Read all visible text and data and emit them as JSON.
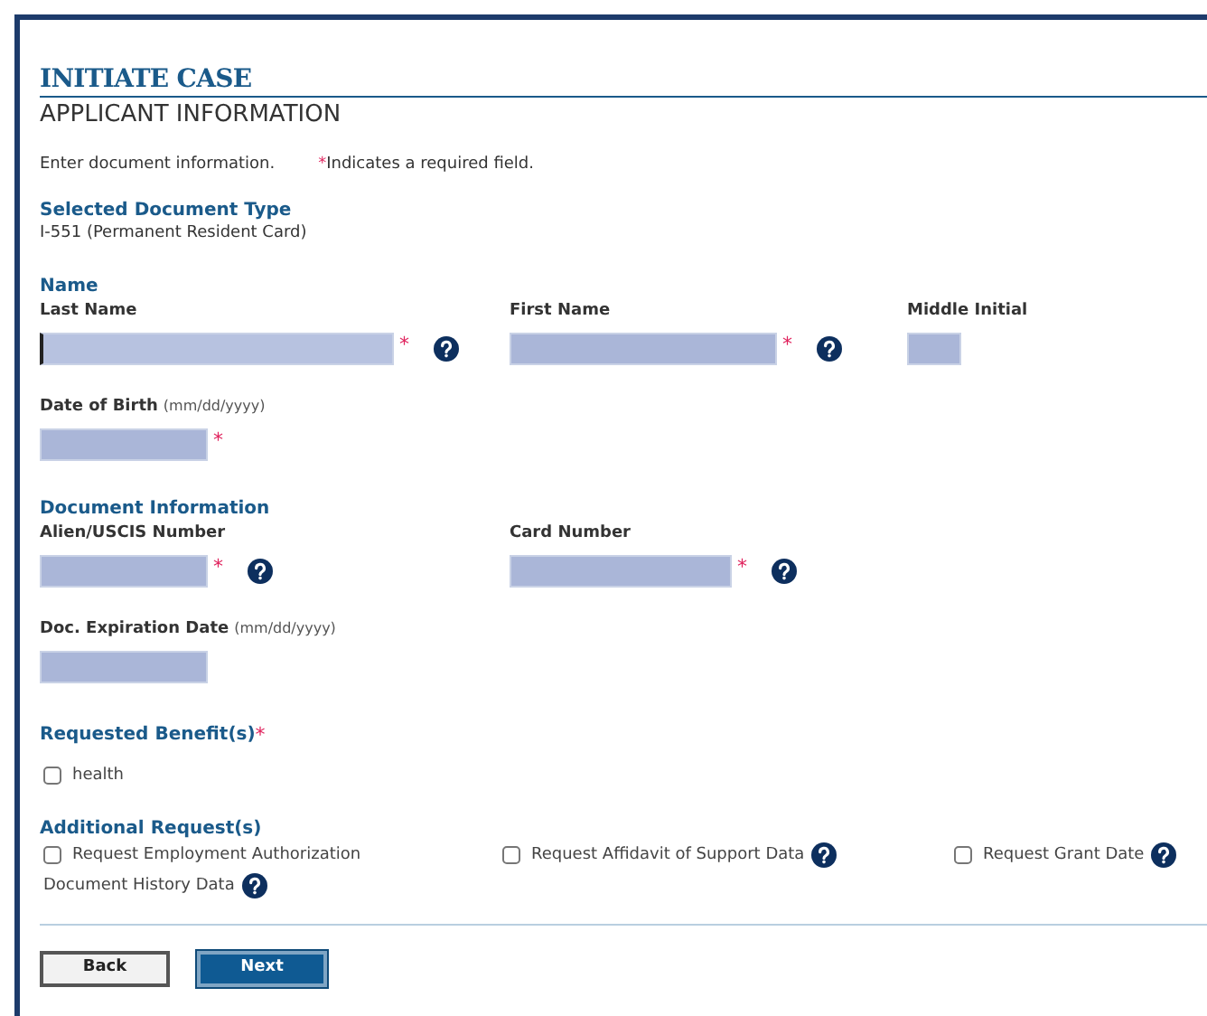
{
  "header": {
    "title": "INITIATE CASE",
    "subtitle": "APPLICANT INFORMATION"
  },
  "intro": {
    "text": "Enter document information.",
    "required_mark": "*",
    "required_note": "Indicates a required field."
  },
  "selected_document": {
    "heading": "Selected Document Type",
    "value": "I-551 (Permanent Resident Card)"
  },
  "sections": [
    {
      "heading": "Name",
      "rows": [
        [
          {
            "label": "Last Name",
            "required": true,
            "help": true,
            "focused": true
          },
          {
            "label": "First Name",
            "required": true,
            "help": true,
            "focused": false
          },
          {
            "label": "Middle Initial",
            "required": false,
            "help": false,
            "focused": false
          }
        ],
        [
          {
            "label": "Date of Birth",
            "hint": "(mm/dd/yyyy)",
            "required": true,
            "help": false,
            "focused": false
          }
        ]
      ]
    },
    {
      "heading": "Document Information",
      "rows": [
        [
          {
            "label": "Alien/USCIS Number",
            "required": true,
            "help": true,
            "focused": false
          },
          {
            "label": "Card Number",
            "required": true,
            "help": true,
            "focused": false
          }
        ],
        [
          {
            "label": "Doc. Expiration Date",
            "hint": "(mm/dd/yyyy)",
            "required": false,
            "help": false,
            "focused": false
          }
        ]
      ]
    }
  ],
  "requested_benefits": {
    "heading": "Requested Benefit(s)",
    "required": true,
    "options": [
      {
        "kind": "checkbox",
        "label": "health",
        "checked": false,
        "help": false
      }
    ]
  },
  "additional_requests": {
    "heading": "Additional Request(s)",
    "required": false,
    "options": [
      {
        "kind": "checkbox",
        "label": "Request Employment Authorization",
        "checked": false,
        "help": false
      },
      {
        "kind": "checkbox",
        "label": "Request Affidavit of Support Data",
        "checked": false,
        "help": true
      },
      {
        "kind": "checkbox",
        "label": "Request Grant Date",
        "checked": false,
        "help": true
      },
      {
        "kind": "text",
        "label": "Document History Data",
        "help": true
      }
    ]
  },
  "buttons": [
    {
      "label": "Back",
      "primary": false
    },
    {
      "label": "Next",
      "primary": true
    }
  ]
}
